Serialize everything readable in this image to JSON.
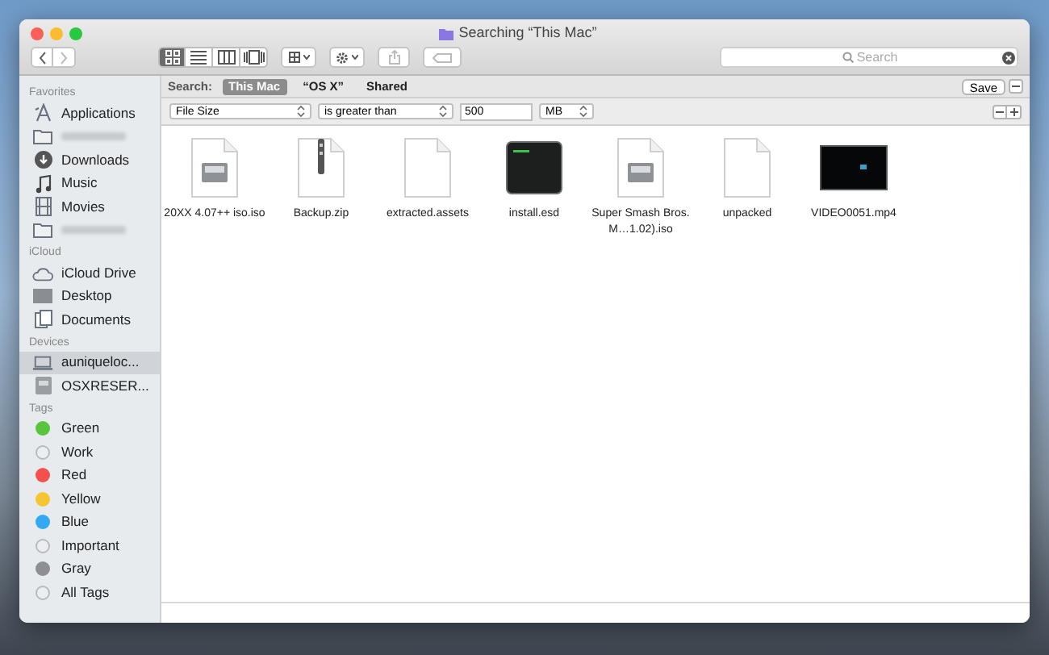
{
  "window": {
    "title": "Searching “This Mac”"
  },
  "toolbar": {
    "views": [
      {
        "kind": "icons",
        "selected": true
      },
      {
        "kind": "list",
        "selected": false
      },
      {
        "kind": "columns",
        "selected": false
      },
      {
        "kind": "coverflow",
        "selected": false
      }
    ],
    "search": {
      "placeholder": "Search"
    }
  },
  "sidebar": [
    {
      "heading": "Favorites",
      "items": [
        {
          "label": "Applications",
          "kind": "apps",
          "selected": false
        },
        {
          "kind": "folder",
          "selected": false
        },
        {
          "label": "Downloads",
          "kind": "download",
          "selected": false
        },
        {
          "label": "Music",
          "kind": "music",
          "selected": false
        },
        {
          "label": "Movies",
          "kind": "film",
          "selected": false
        },
        {
          "kind": "folder",
          "selected": false
        }
      ]
    },
    {
      "heading": "iCloud",
      "items": [
        {
          "label": "iCloud Drive",
          "kind": "cloud",
          "selected": false
        },
        {
          "label": "Desktop",
          "kind": "desktop",
          "selected": false
        },
        {
          "label": "Documents",
          "kind": "documents",
          "selected": false
        }
      ]
    },
    {
      "heading": "Devices",
      "items": [
        {
          "label": "auniqueloc...",
          "kind": "laptop",
          "selected": true
        },
        {
          "label": "OSXRESER...",
          "kind": "disk",
          "selected": false
        }
      ]
    },
    {
      "heading": "Tags",
      "items": [
        {
          "label": "Green",
          "kind": "tag",
          "color": "#5ac43c",
          "selected": false
        },
        {
          "label": "Work",
          "kind": "tag",
          "selected": false
        },
        {
          "label": "Red",
          "kind": "tag",
          "color": "#f4514c",
          "selected": false
        },
        {
          "label": "Yellow",
          "kind": "tag",
          "color": "#f5c533",
          "selected": false
        },
        {
          "label": "Blue",
          "kind": "tag",
          "color": "#33a9f4",
          "selected": false
        },
        {
          "label": "Important",
          "kind": "tag",
          "selected": false
        },
        {
          "label": "Gray",
          "kind": "tag",
          "color": "#8e8e93",
          "selected": false
        },
        {
          "label": "All Tags",
          "kind": "tag",
          "selected": false
        }
      ]
    }
  ],
  "search_bar": {
    "label": "Search:",
    "scopes": [
      {
        "label": "This Mac",
        "selected": true
      },
      {
        "label": "“OS X”",
        "selected": false
      },
      {
        "label": "Shared",
        "selected": false
      }
    ],
    "save": "Save"
  },
  "criteria": {
    "attribute": "File Size",
    "operator": "is greater than",
    "value": "500",
    "unit": "MB"
  },
  "files": [
    {
      "name": "20XX 4.07++ iso.iso",
      "kind": "disk-image"
    },
    {
      "name": "Backup.zip",
      "kind": "zip"
    },
    {
      "name": "extracted.assets",
      "kind": "document"
    },
    {
      "name": "install.esd",
      "kind": "executable"
    },
    {
      "name": "Super Smash Bros. M…1.02).iso",
      "kind": "disk-image"
    },
    {
      "name": "unpacked",
      "kind": "document"
    },
    {
      "name": "VIDEO0051.mp4",
      "kind": "video"
    }
  ]
}
